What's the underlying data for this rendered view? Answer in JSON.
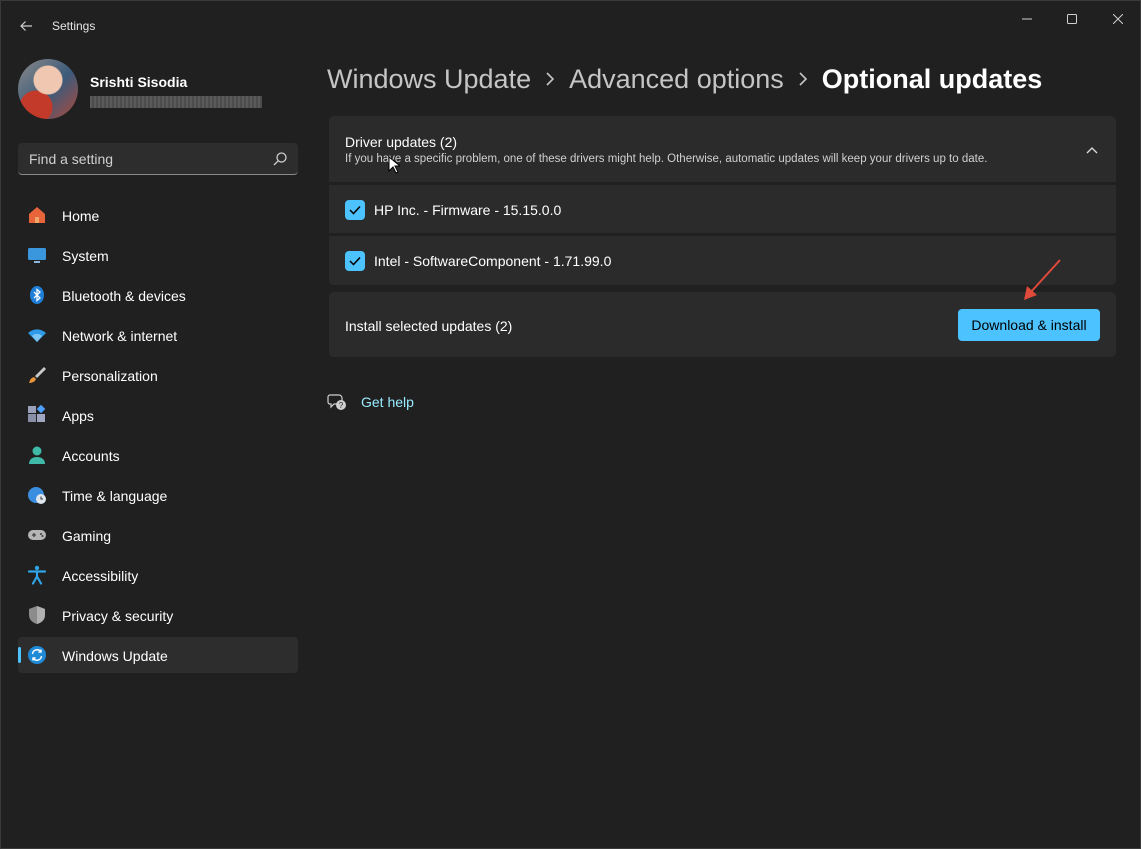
{
  "window": {
    "title": "Settings",
    "controls": {
      "minimize": "minimize-icon",
      "maximize": "maximize-icon",
      "close": "close-icon"
    }
  },
  "profile": {
    "name": "Srishti Sisodia"
  },
  "search": {
    "placeholder": "Find a setting"
  },
  "sidebar": {
    "items": [
      {
        "label": "Home",
        "icon": "home-icon"
      },
      {
        "label": "System",
        "icon": "monitor-icon"
      },
      {
        "label": "Bluetooth & devices",
        "icon": "bluetooth-icon"
      },
      {
        "label": "Network & internet",
        "icon": "wifi-icon"
      },
      {
        "label": "Personalization",
        "icon": "brush-icon"
      },
      {
        "label": "Apps",
        "icon": "apps-icon"
      },
      {
        "label": "Accounts",
        "icon": "person-icon"
      },
      {
        "label": "Time & language",
        "icon": "globe-clock-icon"
      },
      {
        "label": "Gaming",
        "icon": "gamepad-icon"
      },
      {
        "label": "Accessibility",
        "icon": "accessibility-icon"
      },
      {
        "label": "Privacy & security",
        "icon": "shield-icon"
      },
      {
        "label": "Windows Update",
        "icon": "sync-icon",
        "active": true
      }
    ]
  },
  "breadcrumb": [
    "Windows Update",
    "Advanced options",
    "Optional updates"
  ],
  "driver_updates": {
    "title": "Driver updates (2)",
    "description": "If you have a specific problem, one of these drivers might help. Otherwise, automatic updates will keep your drivers up to date.",
    "items": [
      {
        "label": "HP Inc. - Firmware - 15.15.0.0",
        "checked": true
      },
      {
        "label": "Intel - SoftwareComponent - 1.71.99.0",
        "checked": true
      }
    ]
  },
  "install": {
    "label": "Install selected updates (2)",
    "button": "Download & install"
  },
  "help": {
    "label": "Get help"
  },
  "colors": {
    "accent": "#4cc2ff",
    "background": "#202020",
    "card": "#2b2b2b",
    "link": "#99ebff",
    "annotation_arrow": "#e04a3a"
  }
}
